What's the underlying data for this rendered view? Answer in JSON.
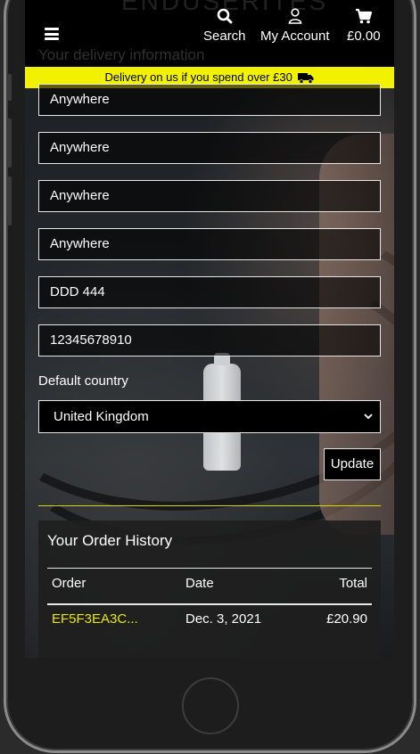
{
  "header": {
    "brand_ghost": "ENDUSERITES",
    "subtitle_ghost": "Your delivery information",
    "nav": {
      "search_label": "Search",
      "account_label": "My Account",
      "bag_total": "£0.00"
    }
  },
  "banner": {
    "text": "Delivery on us if you spend over £30"
  },
  "form": {
    "fields": [
      {
        "value": "Anywhere"
      },
      {
        "value": "Anywhere"
      },
      {
        "value": "Anywhere"
      },
      {
        "value": "Anywhere"
      },
      {
        "value": "DDD 444"
      },
      {
        "value": "12345678910"
      }
    ],
    "country_label": "Default country",
    "country_value": "United Kingdom",
    "update_label": "Update"
  },
  "orders": {
    "title": "Your Order History",
    "headers": {
      "order": "Order",
      "date": "Date",
      "total": "Total"
    },
    "rows": [
      {
        "order": "EF5F3EA3C...",
        "date": "Dec. 3, 2021",
        "total": "£20.90"
      }
    ]
  },
  "colors": {
    "accent": "#f2f200",
    "link": "#e8e800"
  },
  "icons": [
    "hamburger-icon",
    "search-icon",
    "user-icon",
    "shopping-bag-icon",
    "truck-icon",
    "chevron-down-icon"
  ]
}
